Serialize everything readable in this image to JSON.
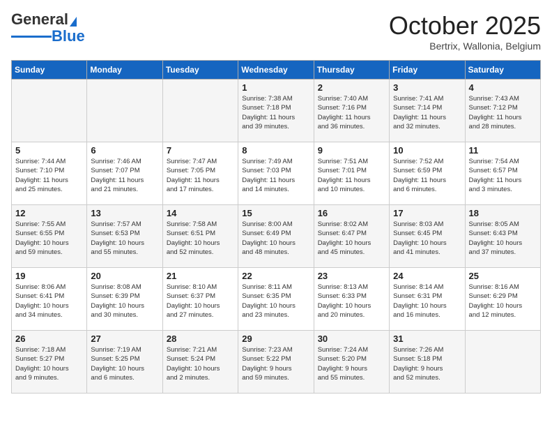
{
  "header": {
    "logo_general": "General",
    "logo_blue": "Blue",
    "month_title": "October 2025",
    "subtitle": "Bertrix, Wallonia, Belgium"
  },
  "days_of_week": [
    "Sunday",
    "Monday",
    "Tuesday",
    "Wednesday",
    "Thursday",
    "Friday",
    "Saturday"
  ],
  "weeks": [
    [
      {
        "num": "",
        "info": ""
      },
      {
        "num": "",
        "info": ""
      },
      {
        "num": "",
        "info": ""
      },
      {
        "num": "1",
        "info": "Sunrise: 7:38 AM\nSunset: 7:18 PM\nDaylight: 11 hours\nand 39 minutes."
      },
      {
        "num": "2",
        "info": "Sunrise: 7:40 AM\nSunset: 7:16 PM\nDaylight: 11 hours\nand 36 minutes."
      },
      {
        "num": "3",
        "info": "Sunrise: 7:41 AM\nSunset: 7:14 PM\nDaylight: 11 hours\nand 32 minutes."
      },
      {
        "num": "4",
        "info": "Sunrise: 7:43 AM\nSunset: 7:12 PM\nDaylight: 11 hours\nand 28 minutes."
      }
    ],
    [
      {
        "num": "5",
        "info": "Sunrise: 7:44 AM\nSunset: 7:10 PM\nDaylight: 11 hours\nand 25 minutes."
      },
      {
        "num": "6",
        "info": "Sunrise: 7:46 AM\nSunset: 7:07 PM\nDaylight: 11 hours\nand 21 minutes."
      },
      {
        "num": "7",
        "info": "Sunrise: 7:47 AM\nSunset: 7:05 PM\nDaylight: 11 hours\nand 17 minutes."
      },
      {
        "num": "8",
        "info": "Sunrise: 7:49 AM\nSunset: 7:03 PM\nDaylight: 11 hours\nand 14 minutes."
      },
      {
        "num": "9",
        "info": "Sunrise: 7:51 AM\nSunset: 7:01 PM\nDaylight: 11 hours\nand 10 minutes."
      },
      {
        "num": "10",
        "info": "Sunrise: 7:52 AM\nSunset: 6:59 PM\nDaylight: 11 hours\nand 6 minutes."
      },
      {
        "num": "11",
        "info": "Sunrise: 7:54 AM\nSunset: 6:57 PM\nDaylight: 11 hours\nand 3 minutes."
      }
    ],
    [
      {
        "num": "12",
        "info": "Sunrise: 7:55 AM\nSunset: 6:55 PM\nDaylight: 10 hours\nand 59 minutes."
      },
      {
        "num": "13",
        "info": "Sunrise: 7:57 AM\nSunset: 6:53 PM\nDaylight: 10 hours\nand 55 minutes."
      },
      {
        "num": "14",
        "info": "Sunrise: 7:58 AM\nSunset: 6:51 PM\nDaylight: 10 hours\nand 52 minutes."
      },
      {
        "num": "15",
        "info": "Sunrise: 8:00 AM\nSunset: 6:49 PM\nDaylight: 10 hours\nand 48 minutes."
      },
      {
        "num": "16",
        "info": "Sunrise: 8:02 AM\nSunset: 6:47 PM\nDaylight: 10 hours\nand 45 minutes."
      },
      {
        "num": "17",
        "info": "Sunrise: 8:03 AM\nSunset: 6:45 PM\nDaylight: 10 hours\nand 41 minutes."
      },
      {
        "num": "18",
        "info": "Sunrise: 8:05 AM\nSunset: 6:43 PM\nDaylight: 10 hours\nand 37 minutes."
      }
    ],
    [
      {
        "num": "19",
        "info": "Sunrise: 8:06 AM\nSunset: 6:41 PM\nDaylight: 10 hours\nand 34 minutes."
      },
      {
        "num": "20",
        "info": "Sunrise: 8:08 AM\nSunset: 6:39 PM\nDaylight: 10 hours\nand 30 minutes."
      },
      {
        "num": "21",
        "info": "Sunrise: 8:10 AM\nSunset: 6:37 PM\nDaylight: 10 hours\nand 27 minutes."
      },
      {
        "num": "22",
        "info": "Sunrise: 8:11 AM\nSunset: 6:35 PM\nDaylight: 10 hours\nand 23 minutes."
      },
      {
        "num": "23",
        "info": "Sunrise: 8:13 AM\nSunset: 6:33 PM\nDaylight: 10 hours\nand 20 minutes."
      },
      {
        "num": "24",
        "info": "Sunrise: 8:14 AM\nSunset: 6:31 PM\nDaylight: 10 hours\nand 16 minutes."
      },
      {
        "num": "25",
        "info": "Sunrise: 8:16 AM\nSunset: 6:29 PM\nDaylight: 10 hours\nand 12 minutes."
      }
    ],
    [
      {
        "num": "26",
        "info": "Sunrise: 7:18 AM\nSunset: 5:27 PM\nDaylight: 10 hours\nand 9 minutes."
      },
      {
        "num": "27",
        "info": "Sunrise: 7:19 AM\nSunset: 5:25 PM\nDaylight: 10 hours\nand 6 minutes."
      },
      {
        "num": "28",
        "info": "Sunrise: 7:21 AM\nSunset: 5:24 PM\nDaylight: 10 hours\nand 2 minutes."
      },
      {
        "num": "29",
        "info": "Sunrise: 7:23 AM\nSunset: 5:22 PM\nDaylight: 9 hours\nand 59 minutes."
      },
      {
        "num": "30",
        "info": "Sunrise: 7:24 AM\nSunset: 5:20 PM\nDaylight: 9 hours\nand 55 minutes."
      },
      {
        "num": "31",
        "info": "Sunrise: 7:26 AM\nSunset: 5:18 PM\nDaylight: 9 hours\nand 52 minutes."
      },
      {
        "num": "",
        "info": ""
      }
    ]
  ]
}
